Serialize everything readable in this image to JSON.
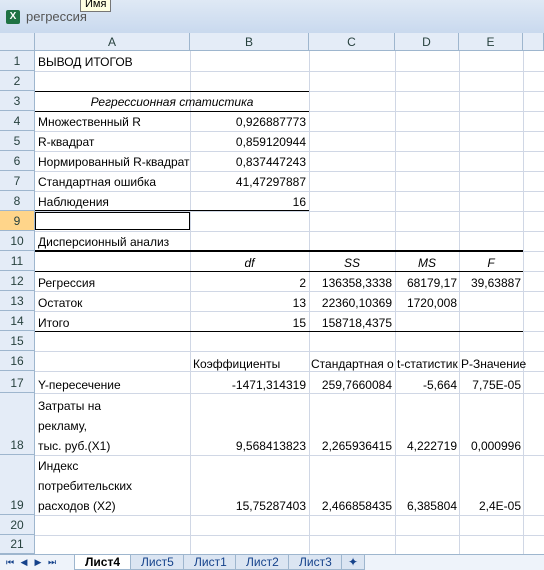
{
  "window": {
    "title": "регрессия",
    "app_icon": "excel-icon",
    "tooltip": "Имя"
  },
  "columns": [
    "A",
    "B",
    "C",
    "D",
    "E"
  ],
  "rows": [
    "1",
    "2",
    "3",
    "4",
    "5",
    "6",
    "7",
    "8",
    "9",
    "10",
    "11",
    "12",
    "13",
    "14",
    "15",
    "16",
    "17",
    "18",
    "19",
    "20",
    "21"
  ],
  "cells": {
    "a1": "ВЫВОД ИТОГОВ",
    "a3": "Регрессионная статистика",
    "a4": "Множественный R",
    "b4": "0,926887773",
    "a5": "R-квадрат",
    "b5": "0,859120944",
    "a6": "Нормированный R-квадрат",
    "b6": "0,837447243",
    "a7": "Стандартная ошибка",
    "b7": "41,47297887",
    "a8": "Наблюдения",
    "b8": "16",
    "a10": "Дисперсионный анализ",
    "b11": "df",
    "c11": "SS",
    "d11": "MS",
    "e11": "F",
    "a12": "Регрессия",
    "b12": "2",
    "c12": "136358,3338",
    "d12": "68179,17",
    "e12": "39,63887",
    "a13": "Остаток",
    "b13": "13",
    "c13": "22360,10369",
    "d13": "1720,008",
    "a14": "Итого",
    "b14": "15",
    "c14": "158718,4375",
    "b16": "Коэффициенты",
    "c16": "Стандартная ошибка",
    "d16": "t-статистика",
    "e16": "P-Значение",
    "a17": "Y-пересечение",
    "b17": "-1471,314319",
    "c17": "259,7660084",
    "d17": "-5,664",
    "e17": "7,75E-05",
    "a18_1": "Затраты на",
    "a18_2": " рекламу,",
    "a18_3": "тыс. руб.(X1)",
    "b18": "9,568413823",
    "c18": "2,265936415",
    "d18": "4,222719",
    "e18": "0,000996",
    "a19_1": "Индекс",
    "a19_2": "потребительских",
    "a19_3": "расходов (X2)",
    "b19": "15,75287403",
    "c19": "2,466858435",
    "d19": "6,385804",
    "e19": "2,4E-05"
  },
  "sheet_tabs": [
    "Лист4",
    "Лист5",
    "Лист1",
    "Лист2",
    "Лист3"
  ],
  "active_tab": "Лист4"
}
